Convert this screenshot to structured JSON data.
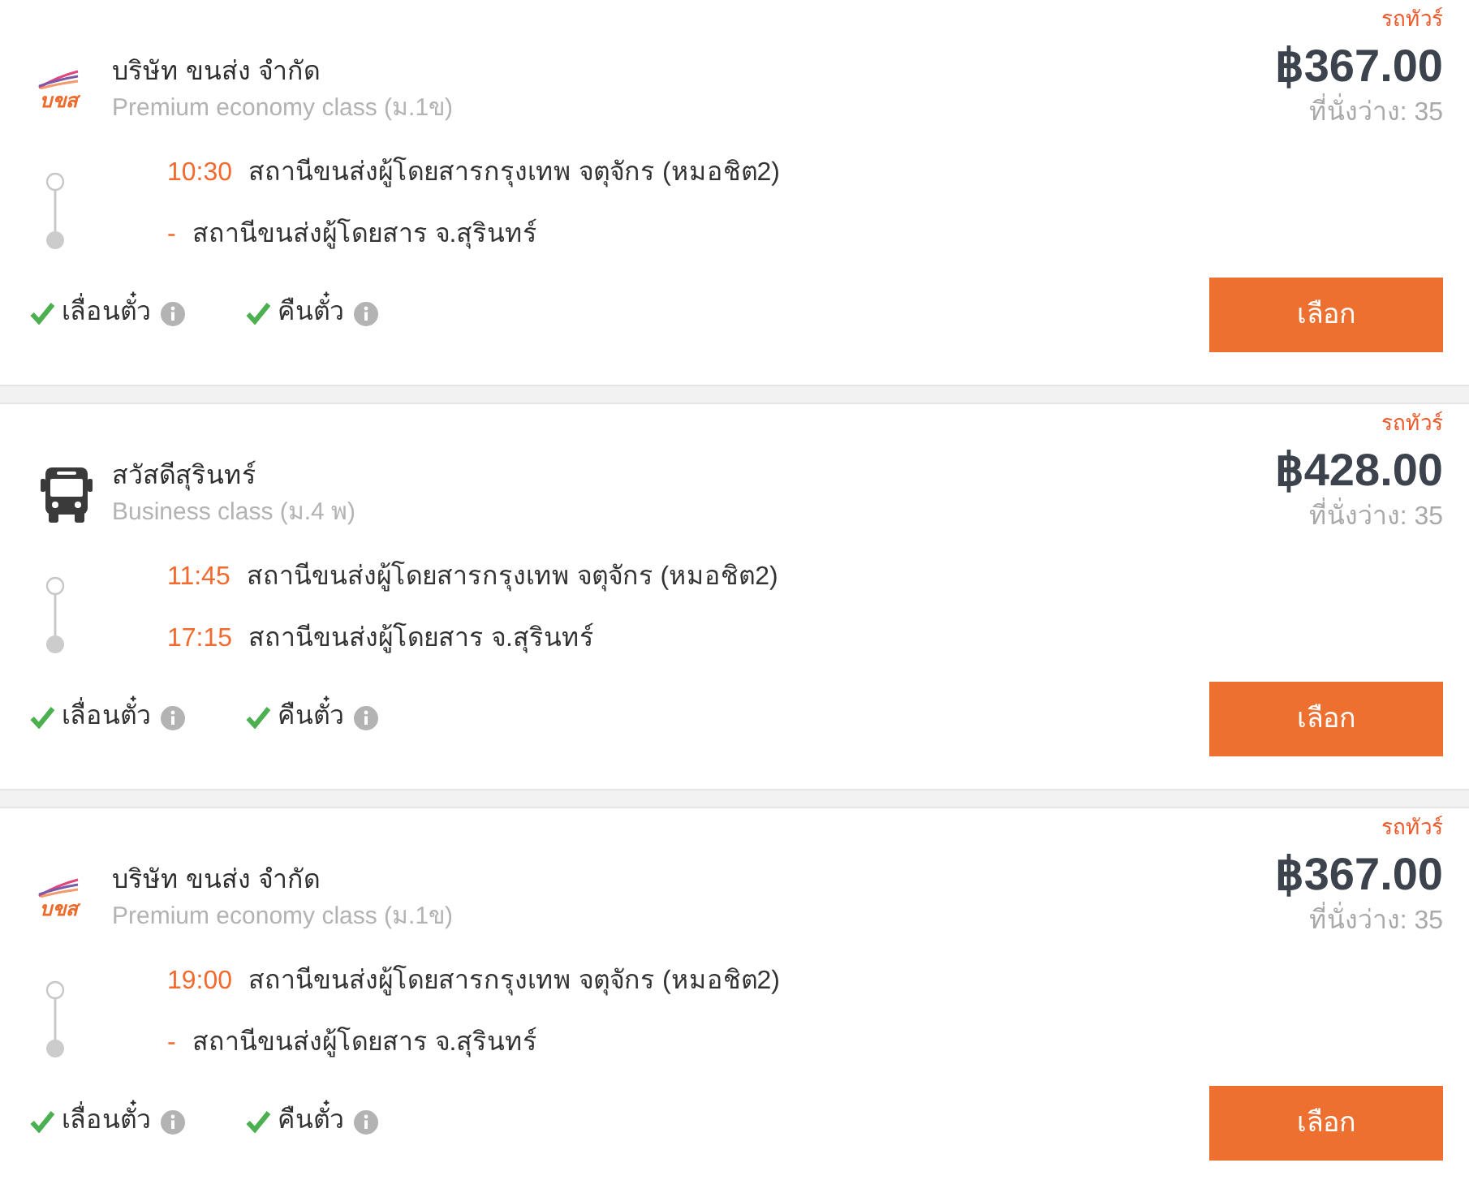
{
  "trips": [
    {
      "tag": "รถทัวร์",
      "logo": {
        "kind": "wordmark",
        "text": "บขส"
      },
      "operator": "บริษัท ขนส่ง จำกัด",
      "bus_class": "Premium economy class (ม.1ข)",
      "stops": [
        {
          "time": "10:30",
          "station": "สถานีขนส่งผู้โดยสารกรุงเทพ จตุจักร (หมอชิต2)"
        },
        {
          "time": "-",
          "station": "สถานีขนส่งผู้โดยสาร จ.สุรินทร์"
        }
      ],
      "price": "฿367.00",
      "seats": "ที่นั่งว่าง: 35",
      "features": [
        {
          "label": "เลื่อนตั๋ว",
          "available": true
        },
        {
          "label": "คืนตั๋ว",
          "available": true
        }
      ],
      "button": "เลือก"
    },
    {
      "tag": "รถทัวร์",
      "logo": {
        "kind": "bus"
      },
      "operator": "สวัสดีสุรินทร์",
      "bus_class": "Business class (ม.4 พ)",
      "stops": [
        {
          "time": "11:45",
          "station": "สถานีขนส่งผู้โดยสารกรุงเทพ จตุจักร (หมอชิต2)"
        },
        {
          "time": "17:15",
          "station": "สถานีขนส่งผู้โดยสาร จ.สุรินทร์"
        }
      ],
      "price": "฿428.00",
      "seats": "ที่นั่งว่าง: 35",
      "features": [
        {
          "label": "เลื่อนตั๋ว",
          "available": true
        },
        {
          "label": "คืนตั๋ว",
          "available": true
        }
      ],
      "button": "เลือก"
    },
    {
      "tag": "รถทัวร์",
      "logo": {
        "kind": "wordmark",
        "text": "บขส"
      },
      "operator": "บริษัท ขนส่ง จำกัด",
      "bus_class": "Premium economy class (ม.1ข)",
      "stops": [
        {
          "time": "19:00",
          "station": "สถานีขนส่งผู้โดยสารกรุงเทพ จตุจักร (หมอชิต2)"
        },
        {
          "time": "-",
          "station": "สถานีขนส่งผู้โดยสาร จ.สุรินทร์"
        }
      ],
      "price": "฿367.00",
      "seats": "ที่นั่งว่าง: 35",
      "features": [
        {
          "label": "เลื่อนตั๋ว",
          "available": true
        },
        {
          "label": "คืนตั๋ว",
          "available": true
        }
      ],
      "button": "เลือก"
    }
  ]
}
